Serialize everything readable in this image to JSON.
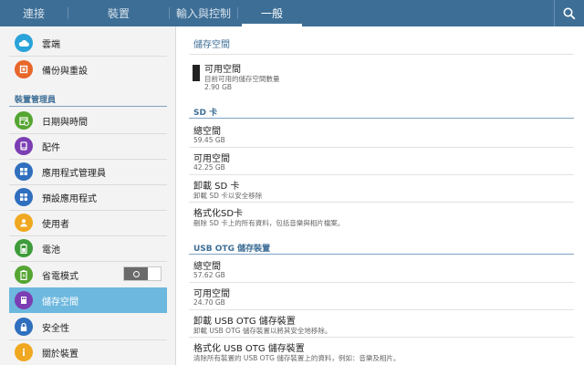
{
  "tabs": [
    {
      "label": "連接",
      "active": false
    },
    {
      "label": "裝置",
      "active": false
    },
    {
      "label": "輸入與控制",
      "active": false
    },
    {
      "label": "一般",
      "active": true
    }
  ],
  "sidebar": {
    "top_items": [
      {
        "label": "雲端",
        "icon": "cloud-icon",
        "color": "#29a3d9"
      },
      {
        "label": "備份與重設",
        "icon": "backup-icon",
        "color": "#e8662a"
      }
    ],
    "section_header": "裝置管理員",
    "items": [
      {
        "label": "日期與時間",
        "icon": "calendar-clock-icon",
        "color": "#55a532"
      },
      {
        "label": "配件",
        "icon": "accessory-icon",
        "color": "#7b3eb3"
      },
      {
        "label": "應用程式管理員",
        "icon": "apps-grid-icon",
        "color": "#2f6fbe"
      },
      {
        "label": "預設應用程式",
        "icon": "default-apps-icon",
        "color": "#2f6fbe"
      },
      {
        "label": "使用者",
        "icon": "user-icon",
        "color": "#f0a820"
      },
      {
        "label": "電池",
        "icon": "battery-icon",
        "color": "#3e9c3a"
      },
      {
        "label": "省電模式",
        "icon": "power-saving-icon",
        "color": "#55a532",
        "toggle": false
      },
      {
        "label": "儲存空間",
        "icon": "storage-icon",
        "color": "#7b3eb3",
        "active": true
      },
      {
        "label": "安全性",
        "icon": "lock-icon",
        "color": "#2f6fbe"
      },
      {
        "label": "關於裝置",
        "icon": "info-icon",
        "color": "#f0a820"
      }
    ]
  },
  "content": {
    "title": "儲存空間",
    "internal": {
      "available_title": "可用空間",
      "available_desc": "目前可用的儲存空間數量",
      "available_value": "2.90 GB"
    },
    "sd_card": {
      "header": "SD 卡",
      "rows": [
        {
          "title": "總空間",
          "sub": "59.45 GB"
        },
        {
          "title": "可用空間",
          "sub": "42.25 GB"
        },
        {
          "title": "卸載 SD 卡",
          "sub": "卸載 SD 卡以安全移除"
        },
        {
          "title": "格式化SD卡",
          "sub": "刪除 SD 卡上的所有資料，包括音樂與相片檔案。"
        }
      ]
    },
    "usb_otg": {
      "header": "USB OTG 儲存裝置",
      "rows": [
        {
          "title": "總空間",
          "sub": "57.62 GB"
        },
        {
          "title": "可用空間",
          "sub": "24.70 GB"
        },
        {
          "title": "卸載 USB OTG 儲存裝置",
          "sub": "卸載 USB OTG 儲存裝置以將其安全地移除。"
        },
        {
          "title": "格式化 USB OTG 儲存裝置",
          "sub": "清除所有裝置的 USB OTG 儲存裝置上的資料，例如：音樂及相片。"
        }
      ]
    }
  }
}
